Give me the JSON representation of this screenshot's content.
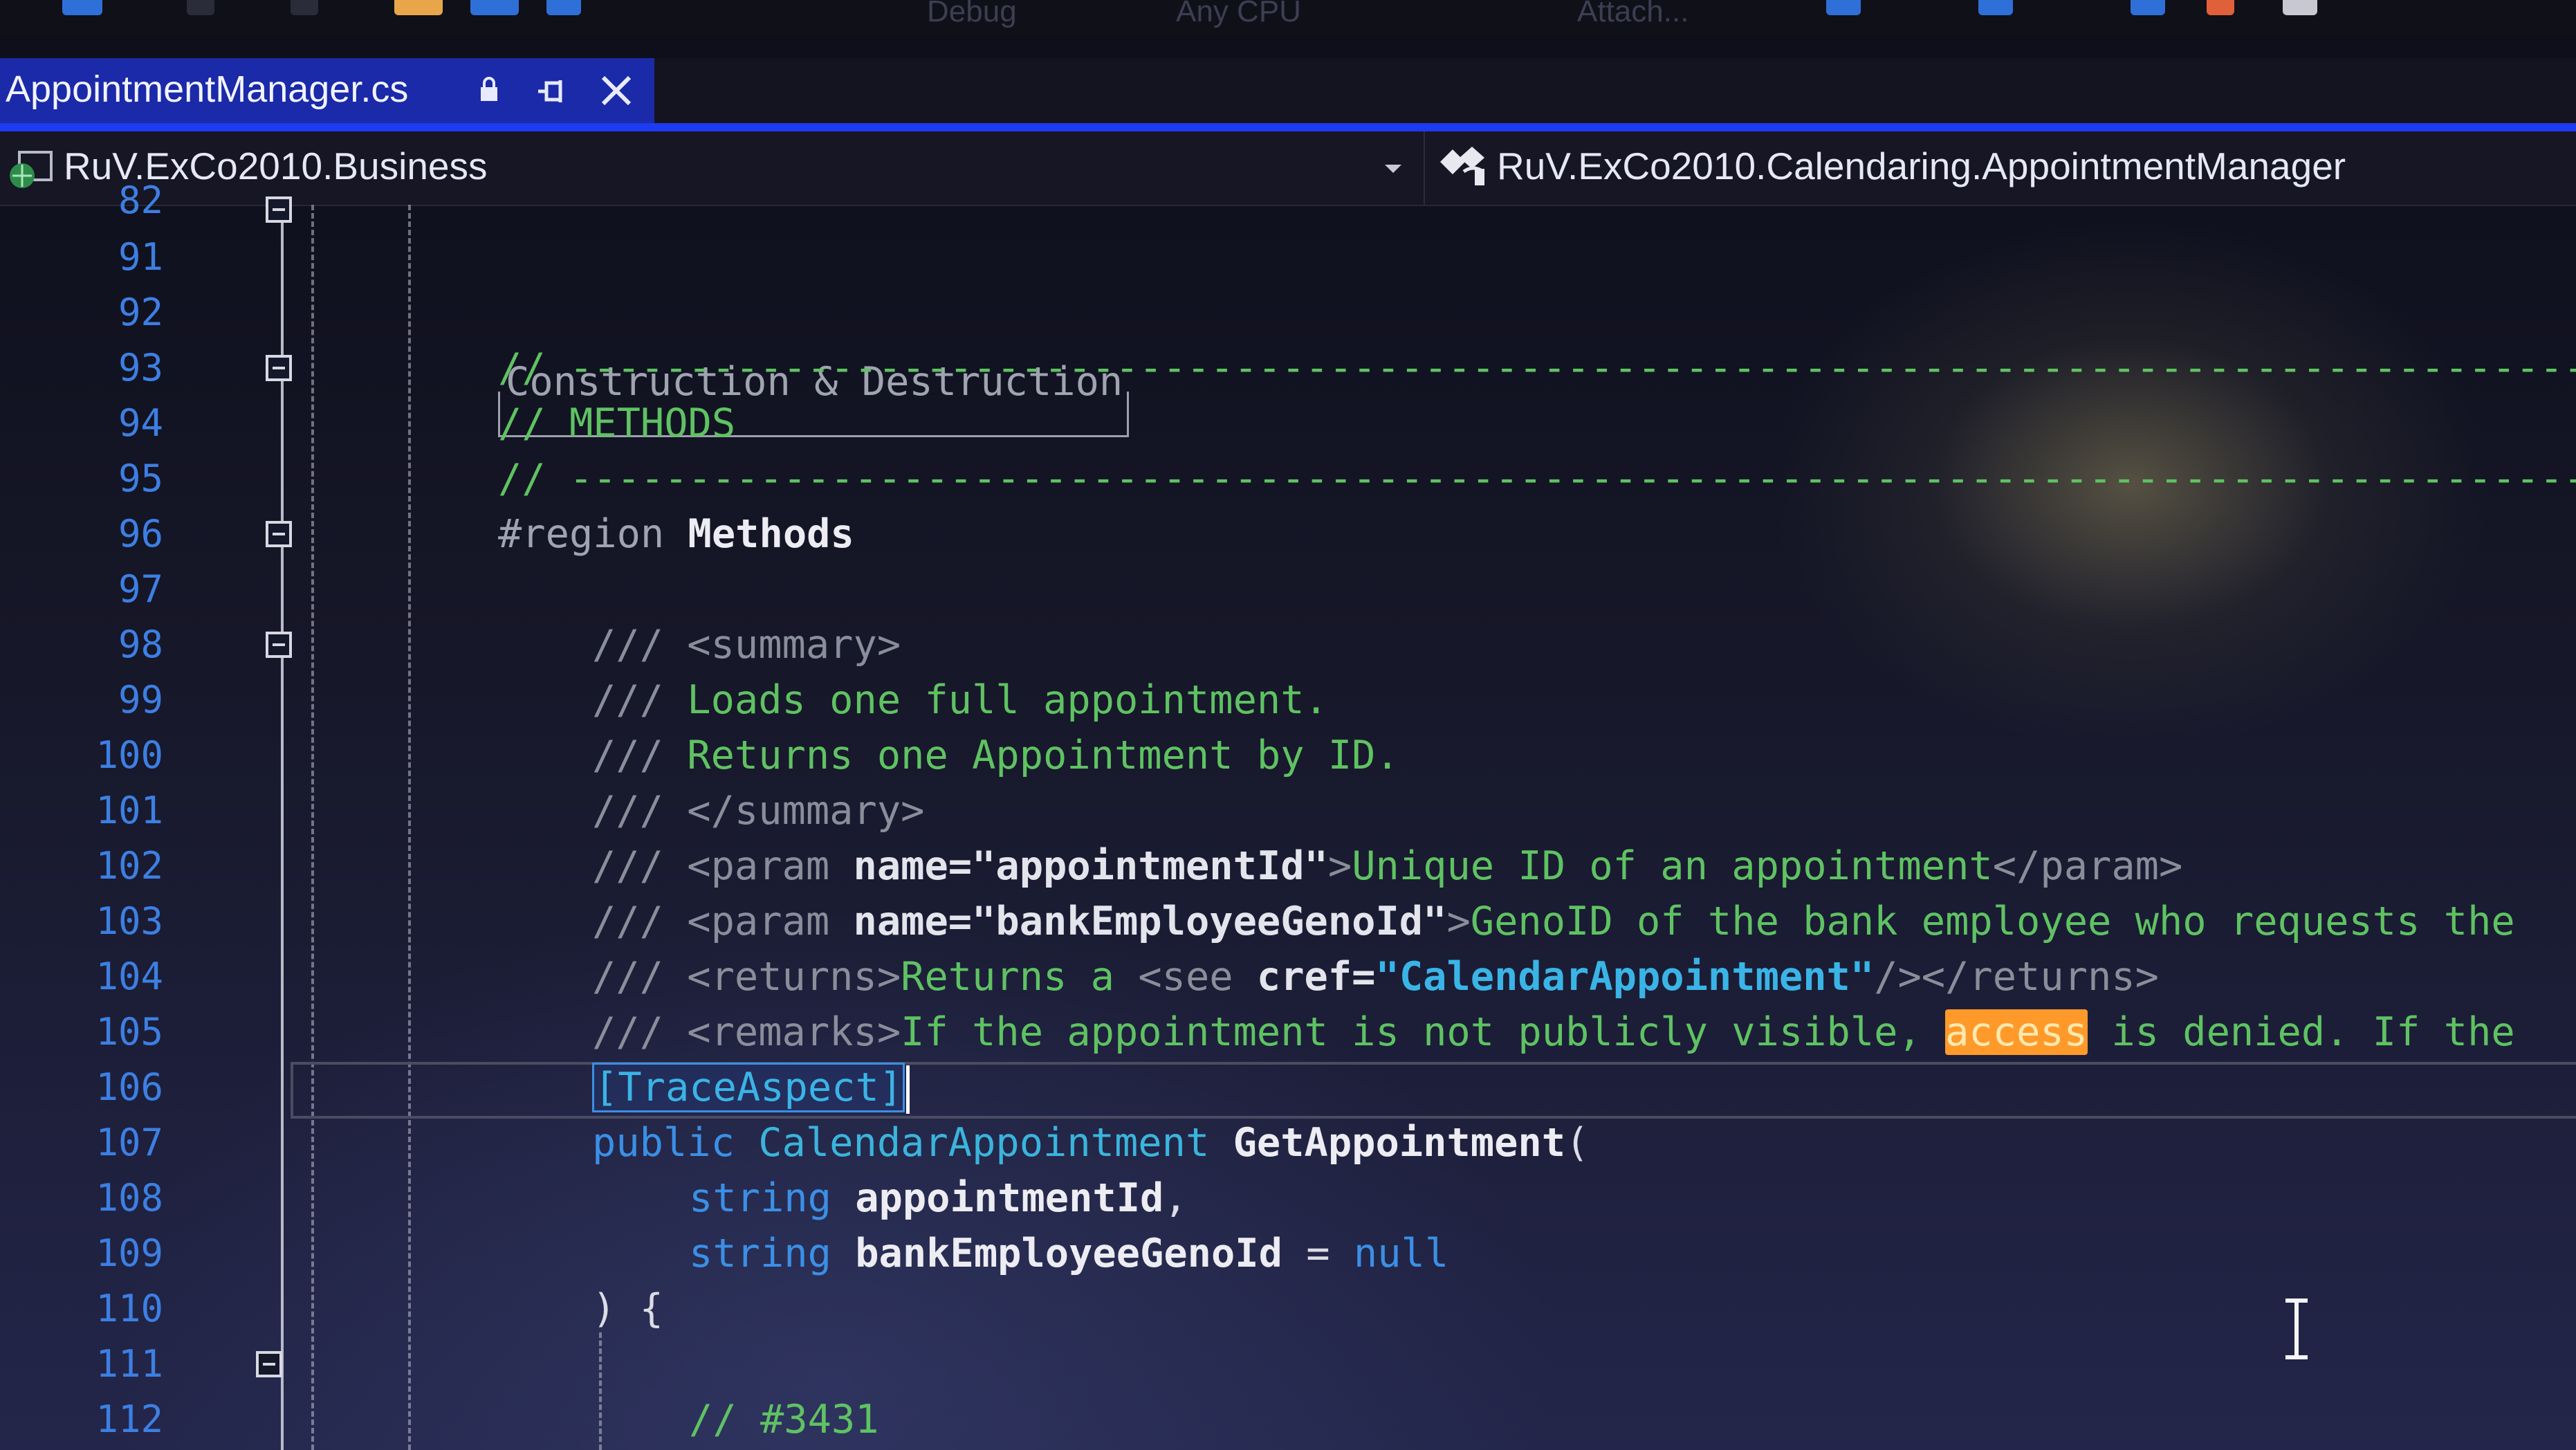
{
  "toolbar": {
    "cut_off_labels": [
      "Debug",
      "Any CPU",
      "Attach..."
    ]
  },
  "tab": {
    "title": "AppointmentManager.cs",
    "lock_glyph": "🔒",
    "pin_glyph": "⊣",
    "close_glyph": "✕"
  },
  "navbar": {
    "project": "RuV.ExCo2010.Business",
    "type": "RuV.ExCo2010.Calendaring.AppointmentManager"
  },
  "editor": {
    "top_partial_line_number": "82",
    "top_partial_text": "Construction & Destruction",
    "lines": [
      {
        "n": "91"
      },
      {
        "n": "92"
      },
      {
        "n": "93",
        "c1": "// ----------------------------------------------------------------------------------------------------------"
      },
      {
        "n": "94",
        "c1": "// METHODS"
      },
      {
        "n": "95",
        "c1": "// ----------------------------------------------------------------------------------------------------------"
      },
      {
        "n": "96",
        "kw": "#region",
        "name": "Methods"
      },
      {
        "n": "97"
      },
      {
        "n": "98",
        "slash": "///",
        "t1": "<summary>"
      },
      {
        "n": "99",
        "slash": "///",
        "txt": "Loads one full appointment."
      },
      {
        "n": "100",
        "slash": "///",
        "txt": "Returns one Appointment by ID."
      },
      {
        "n": "101",
        "slash": "///",
        "t1": "</summary>"
      },
      {
        "n": "102",
        "slash": "///",
        "t1": "<param ",
        "attr": "name=",
        "str": "\"appointmentId\"",
        "t2": ">",
        "txt": "Unique ID of an appointment",
        "t3": "</param>"
      },
      {
        "n": "103",
        "slash": "///",
        "t1": "<param ",
        "attr": "name=",
        "str": "\"bankEmployeeGenoId\"",
        "t2": ">",
        "txt": "GenoID of the bank employee who requests the"
      },
      {
        "n": "104",
        "slash": "///",
        "t1": "<returns>",
        "txt": "Returns a ",
        "t2": "<see ",
        "attr": "cref=",
        "cref": "\"CalendarAppointment\"",
        "t3": "/></returns>"
      },
      {
        "n": "105",
        "slash": "///",
        "t1": "<remarks>",
        "txt": "If the appointment is not publicly visible, ",
        "hl": "access",
        "txt2": " is denied. If the"
      },
      {
        "n": "106",
        "attr_text": "[TraceAspect]"
      },
      {
        "n": "107",
        "kw": "public",
        "type": "CalendarAppointment",
        "name": "GetAppointment",
        "rest": "("
      },
      {
        "n": "108",
        "kw": "string",
        "name": "appointmentId",
        "rest": ","
      },
      {
        "n": "109",
        "kw": "string",
        "name": "bankEmployeeGenoId",
        "op": " = ",
        "lit": "null"
      },
      {
        "n": "110",
        "rest": ") {"
      },
      {
        "n": "111"
      },
      {
        "n": "112",
        "c1": "// #3431"
      }
    ]
  },
  "colors": {
    "tab_active": "#1a2aa8",
    "line_number": "#3d7fe3",
    "comment": "#5fc262",
    "keyword": "#3b8fe6",
    "type": "#3bb4dc",
    "highlight": "#ff9a2a"
  },
  "icons": [
    "lock-icon",
    "pin-icon",
    "close-icon",
    "project-icon",
    "dropdown-arrow-icon",
    "class-icon",
    "fold-toggle-icon",
    "ibeam-cursor-icon"
  ]
}
